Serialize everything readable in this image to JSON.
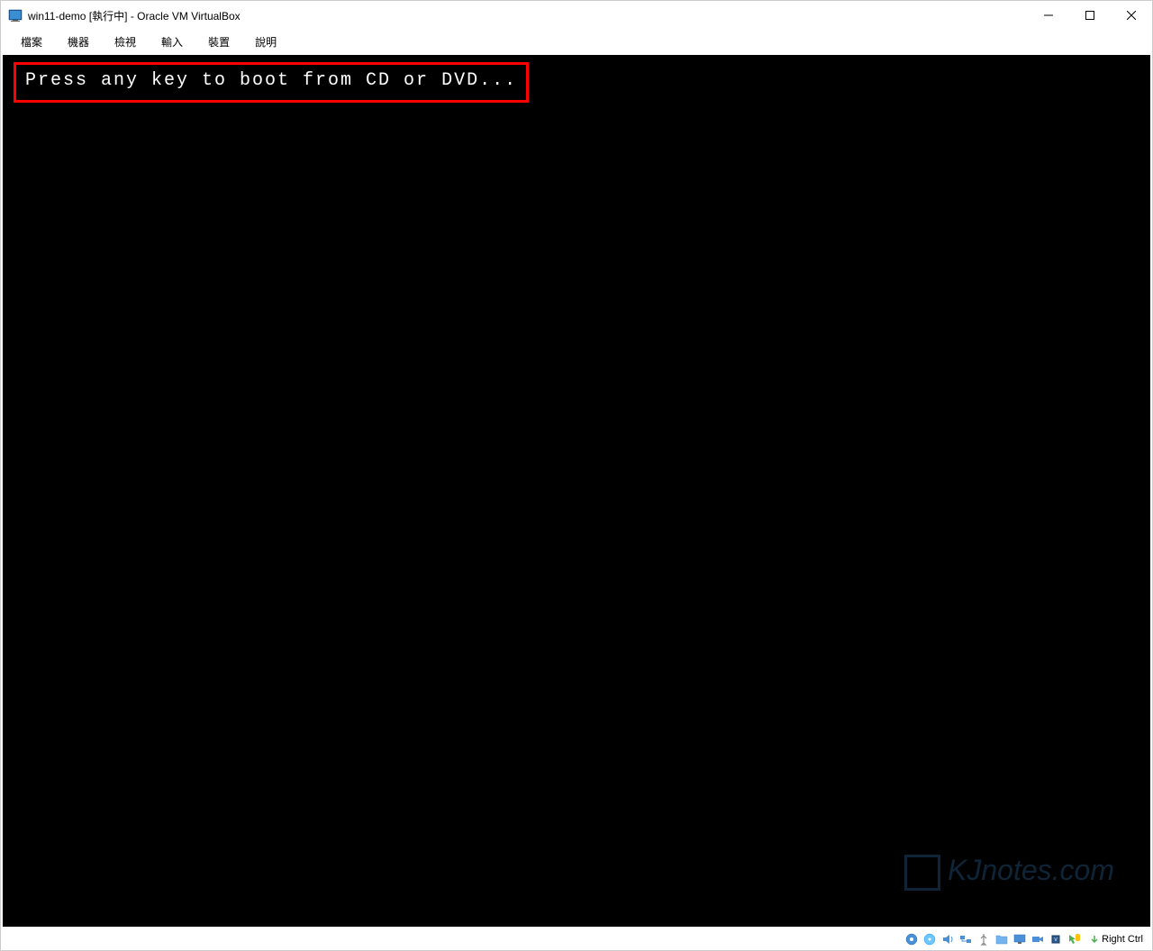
{
  "titlebar": {
    "title": "win11-demo [執行中] - Oracle VM VirtualBox"
  },
  "menubar": {
    "items": [
      {
        "label": "檔案"
      },
      {
        "label": "機器"
      },
      {
        "label": "檢視"
      },
      {
        "label": "輸入"
      },
      {
        "label": "裝置"
      },
      {
        "label": "說明"
      }
    ]
  },
  "vm": {
    "boot_message": "Press any key to boot from CD or DVD..."
  },
  "statusbar": {
    "host_key": "Right Ctrl"
  },
  "watermark": {
    "text": "KJnotes.com"
  }
}
